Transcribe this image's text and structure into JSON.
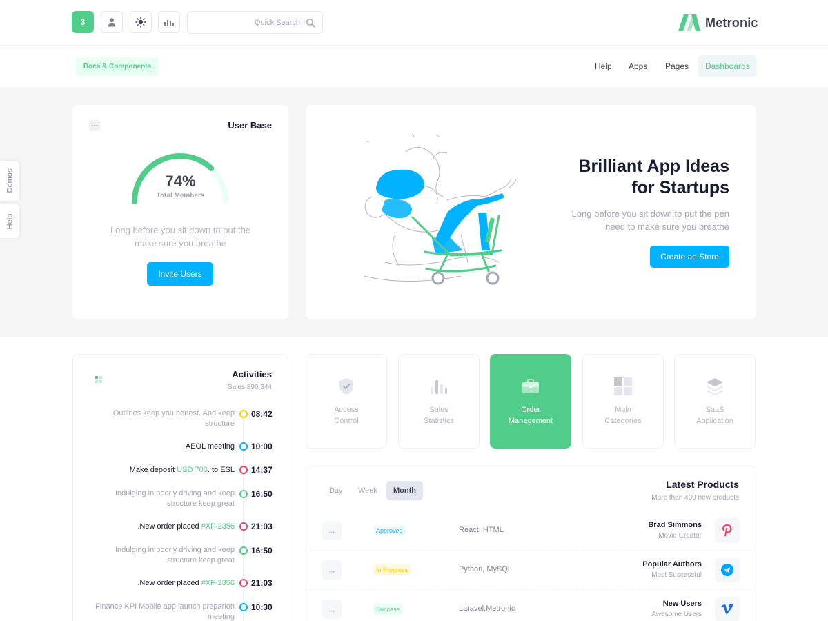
{
  "header": {
    "notification_count": "3",
    "search_placeholder": "Quick Search",
    "brand_name": "Metronic"
  },
  "subnav": {
    "docs_label": "Docs & Components",
    "items": [
      {
        "label": "Help"
      },
      {
        "label": "Apps"
      },
      {
        "label": "Pages"
      },
      {
        "label": "Dashboards",
        "active": true
      }
    ]
  },
  "side_tabs": [
    "Demos",
    "Help"
  ],
  "user_base": {
    "title": "User Base",
    "menu_glyph": "···",
    "percent_label": "74%",
    "percent": 0.74,
    "metric_label": "Total Members",
    "description": "Long before you sit down to put the make sure you breathe",
    "button_label": "Invite Users"
  },
  "hero": {
    "title_line1": "Brilliant App Ideas",
    "title_line2": "for Startups",
    "description": "Long before you sit down to put the pen need to make sure you breathe",
    "button_label": "Create an Store"
  },
  "activities": {
    "title": "Activities",
    "subtitle": "Sales 890,344",
    "items": [
      {
        "text": "Outlines keep you honest. And keep structure",
        "time": "08:42",
        "style": "muted",
        "color": "#ffc700"
      },
      {
        "text": "AEOL meeting",
        "time": "10:00",
        "style": "strong",
        "color": "#00b2ff"
      },
      {
        "text_before": "Make deposit ",
        "highlight": "USD 700",
        "text_after": ". to ESL",
        "time": "14:37",
        "style": "strong",
        "color": "#f1416c"
      },
      {
        "text": "Indulging in poorly driving and keep structure keep great",
        "time": "16:50",
        "style": "muted",
        "color": "#50cd89"
      },
      {
        "text_before": ".New order placed ",
        "highlight": "#XF-2356",
        "text_after": "",
        "time": "21:03",
        "style": "strong",
        "color": "#f1416c"
      },
      {
        "text": "Indulging in poorly driving and keep structure keep great",
        "time": "16:50",
        "style": "muted",
        "color": "#50cd89"
      },
      {
        "text_before": ".New order placed ",
        "highlight": "#XF-2356",
        "text_after": "",
        "time": "21:03",
        "style": "strong",
        "color": "#f1416c"
      },
      {
        "text": "Finance KPI Mobile app launch preparion meeting",
        "time": "10:30",
        "style": "muted",
        "color": "#00b2ff"
      }
    ]
  },
  "categories": [
    {
      "line1": "Access",
      "line2": "Control",
      "icon": "shield-icon"
    },
    {
      "line1": "Sales",
      "line2": "Statistics",
      "icon": "bar-chart-icon"
    },
    {
      "line1": "Order",
      "line2": "Management",
      "icon": "briefcase-icon",
      "active": true
    },
    {
      "line1": "Main",
      "line2": "Categories",
      "icon": "grid-icon"
    },
    {
      "line1": "SaaS",
      "line2": "Application",
      "icon": "layers-icon"
    }
  ],
  "products": {
    "title": "Latest Products",
    "subtitle": "More than 400 new products",
    "tabs": [
      {
        "label": "Day"
      },
      {
        "label": "Week"
      },
      {
        "label": "Month",
        "active": true
      }
    ],
    "rows": [
      {
        "status": "Approved",
        "status_color": "#00b2ff",
        "status_bg": "#f1faff",
        "tech": "React, HTML",
        "name": "Brad Simmons",
        "role": "Movie Creator",
        "logo": "pinterest-icon"
      },
      {
        "status": "In Progress",
        "status_color": "#ffc700",
        "status_bg": "#fff8dd",
        "tech": "Python, MySQL",
        "name": "Popular Authors",
        "role": "Most Successful",
        "logo": "telegram-icon"
      },
      {
        "status": "Success",
        "status_color": "#50cd89",
        "status_bg": "#e8fff3",
        "tech": "Laravel,Metronic",
        "name": "New Users",
        "role": "Awesome Users",
        "logo": "vimeo-icon"
      }
    ]
  },
  "colors": {
    "brand_green": "#50cd89",
    "primary_blue": "#00b2ff",
    "danger": "#f1416c",
    "warning": "#ffc700"
  }
}
